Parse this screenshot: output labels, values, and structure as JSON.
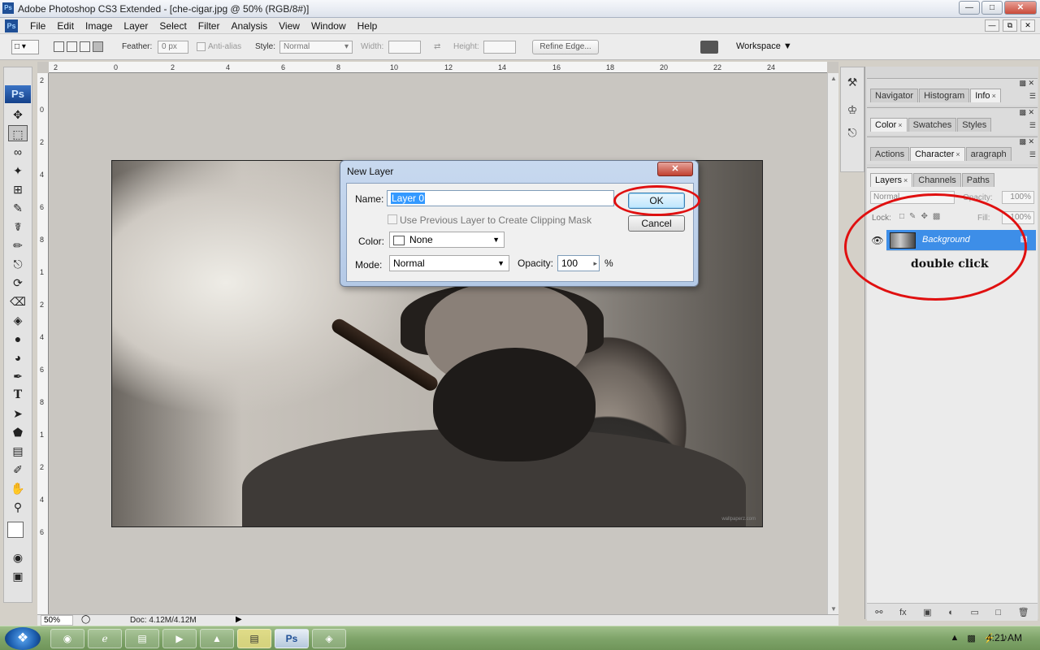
{
  "window": {
    "title": "Adobe Photoshop CS3 Extended - [che-cigar.jpg @ 50% (RGB/8#)]",
    "app_icon": "Ps"
  },
  "menubar": {
    "icon": "Ps",
    "items": [
      "File",
      "Edit",
      "Image",
      "Layer",
      "Select",
      "Filter",
      "Analysis",
      "View",
      "Window",
      "Help"
    ]
  },
  "options": {
    "feather_label": "Feather:",
    "feather_value": "0 px",
    "antialias_label": "Anti-alias",
    "style_label": "Style:",
    "style_value": "Normal",
    "width_label": "Width:",
    "height_label": "Height:",
    "refine_edge": "Refine Edge...",
    "workspace": "Workspace ▼"
  },
  "toolbox": {
    "logo": "Ps"
  },
  "ruler": {
    "top": [
      "2",
      "0",
      "2",
      "4",
      "6",
      "8",
      "10",
      "12",
      "14",
      "16",
      "18",
      "20",
      "22",
      "24"
    ],
    "left": [
      "2",
      "0",
      "2",
      "4",
      "6",
      "8",
      "1",
      "2",
      "4",
      "6",
      "8",
      "1",
      "2",
      "4",
      "6"
    ]
  },
  "dialog": {
    "title": "New Layer",
    "name_label": "Name:",
    "name_value": "Layer 0",
    "clip_label": "Use Previous Layer to Create Clipping Mask",
    "color_label": "Color:",
    "color_value": "None",
    "mode_label": "Mode:",
    "mode_value": "Normal",
    "opacity_label": "Opacity:",
    "opacity_value": "100",
    "opacity_unit": "%",
    "ok": "OK",
    "cancel": "Cancel"
  },
  "panels": {
    "group1": [
      {
        "label": "Navigator"
      },
      {
        "label": "Histogram"
      },
      {
        "label": "Info",
        "close": "×"
      }
    ],
    "group2": [
      {
        "label": "Color",
        "close": "×"
      },
      {
        "label": "Swatches"
      },
      {
        "label": "Styles"
      }
    ],
    "group3": [
      {
        "label": "Actions"
      },
      {
        "label": "Character",
        "close": "×"
      },
      {
        "label": "aragraph"
      }
    ],
    "layers_tabs": [
      {
        "label": "Layers",
        "close": "×"
      },
      {
        "label": "Channels"
      },
      {
        "label": "Paths"
      }
    ]
  },
  "layers": {
    "blend_mode": "Normal",
    "opacity_label": "Opacity:",
    "opacity_value": "100%",
    "lock_label": "Lock:",
    "fill_label": "Fill:",
    "fill_value": "100%",
    "layer_name": "Background",
    "annotation": "double click"
  },
  "statusbar": {
    "zoom": "50%",
    "doc": "Doc: 4.12M/4.12M"
  },
  "photo": {
    "watermark": "wallpaperz.com"
  },
  "taskbar": {
    "time": "4:21 AM"
  },
  "colors": {
    "accent": "#3d8ee8",
    "annotation_ring": "#e01010",
    "dialog_title": "#c8d9ef"
  }
}
